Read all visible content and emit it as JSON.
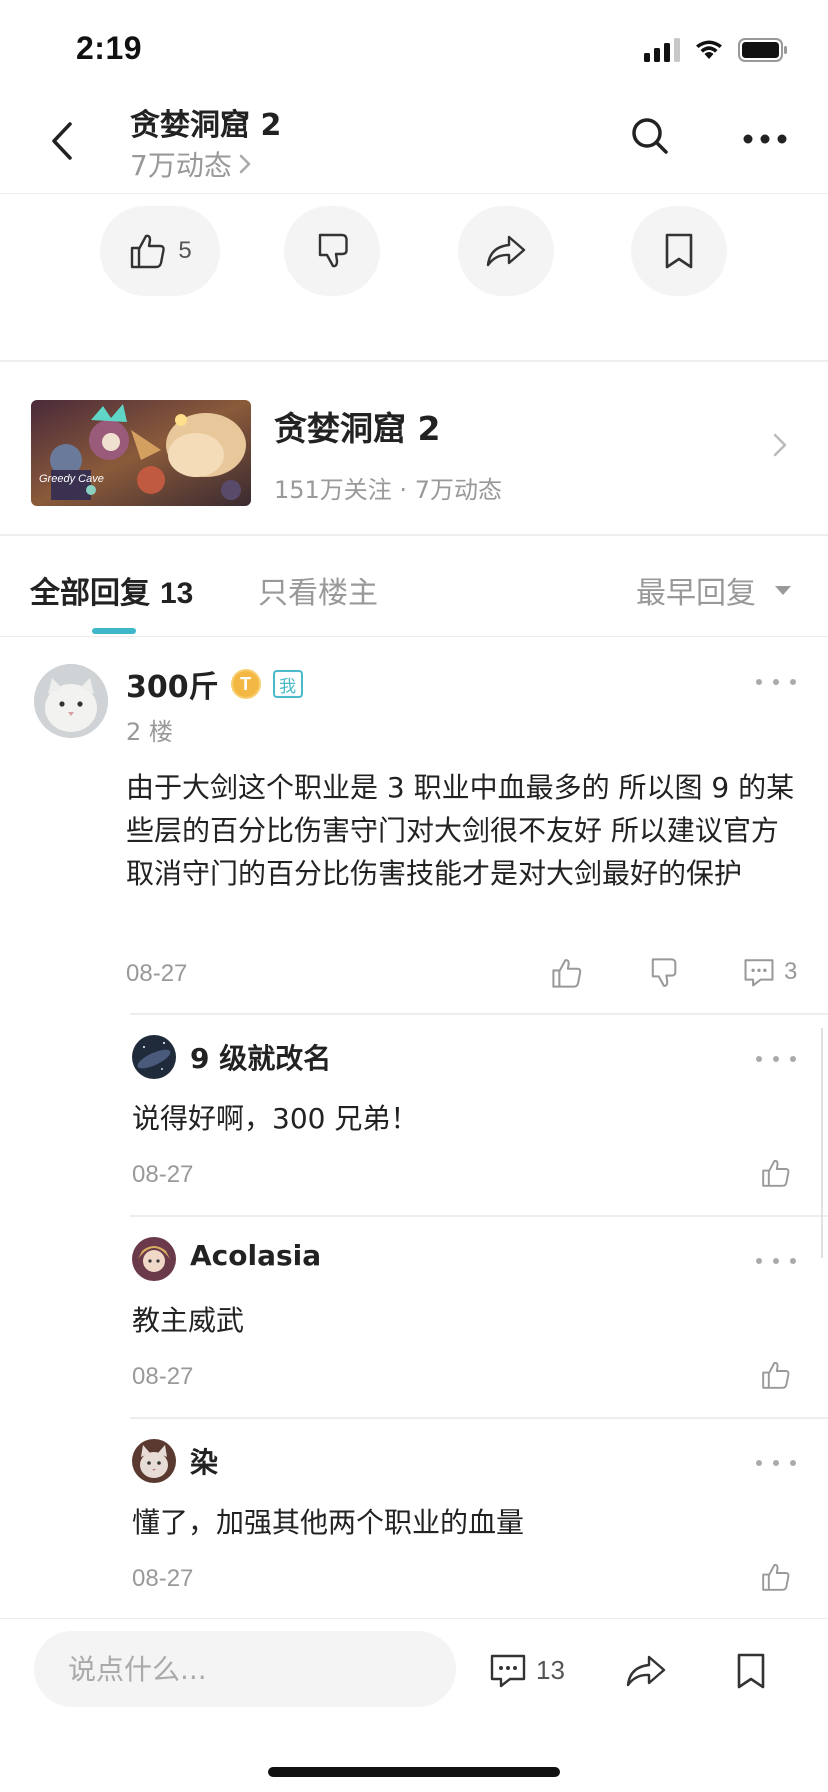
{
  "status": {
    "time": "2:19"
  },
  "header": {
    "title": "贪婪洞窟 2",
    "subtitle": "7万动态"
  },
  "post_actions": {
    "like_count": "5"
  },
  "game": {
    "name": "贪婪洞窟 2",
    "stats": "151万关注 · 7万动态",
    "thumbnail_logo_text": "Greedy Cave"
  },
  "tabs": {
    "all_label": "全部回复",
    "all_count": "13",
    "op_only_label": "只看楼主",
    "sort_label": "最早回复"
  },
  "comment": {
    "username": "300斤",
    "badge_letter": "T",
    "badge_me": "我",
    "floor": "2 楼",
    "body": "由于大剑这个职业是 3 职业中血最多的 所以图 9 的某些层的百分比伤害守门对大剑很不友好 所以建议官方取消守门的百分比伤害技能才是对大剑最好的保护",
    "date": "08-27",
    "reply_count": "3"
  },
  "replies": [
    {
      "username": "9 级就改名",
      "text": "说得好啊，300 兄弟！",
      "date": "08-27"
    },
    {
      "username": "Acolasia",
      "text": "教主威武",
      "date": "08-27"
    },
    {
      "username": "染",
      "text": "懂了，加强其他两个职业的血量",
      "date": "08-27"
    }
  ],
  "bottom_bar": {
    "input_placeholder": "说点什么...",
    "comment_count": "13"
  },
  "colors": {
    "accent": "#3eb8c9",
    "gold_badge": "#f3b844",
    "muted_text": "#999999"
  }
}
